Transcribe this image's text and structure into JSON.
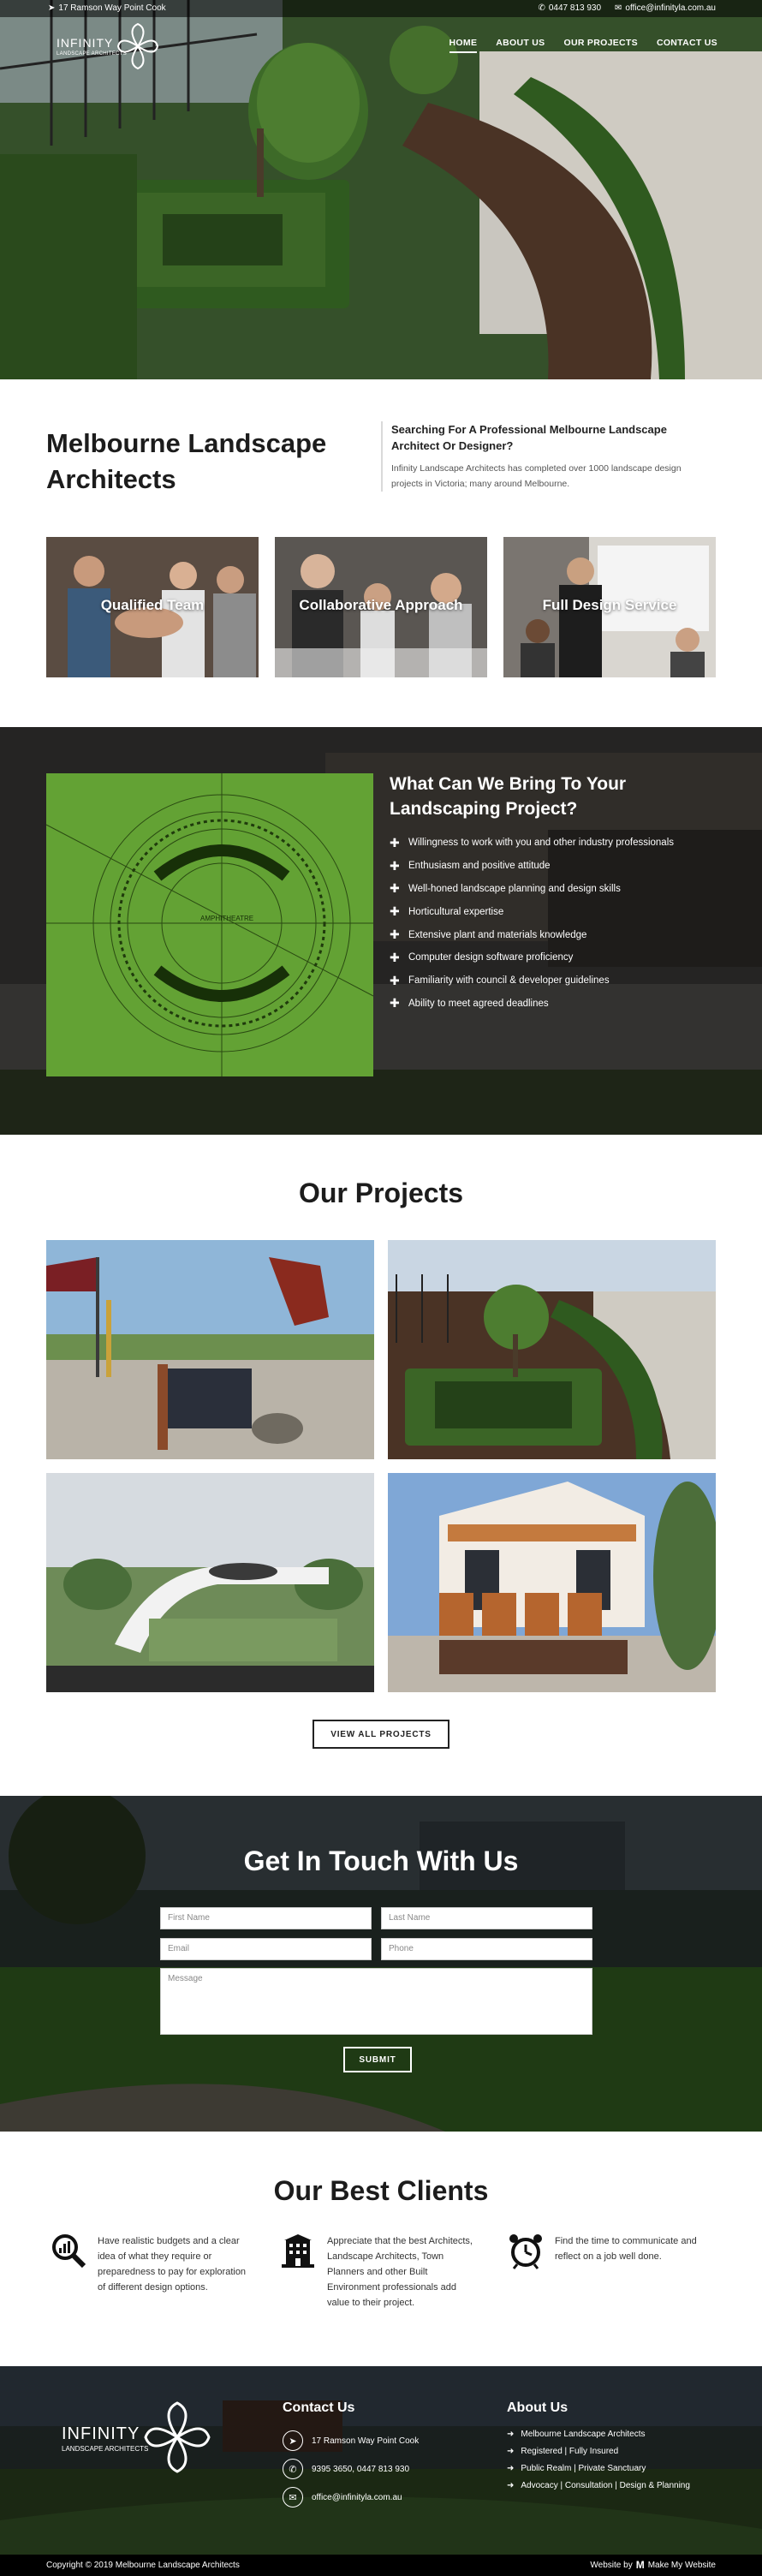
{
  "topbar": {
    "address": "17 Ramson Way Point Cook",
    "phone": "0447 813 930",
    "email": "office@infinityla.com.au"
  },
  "logo": {
    "name": "INFINITY",
    "tagline": "LANDSCAPE ARCHITECTS"
  },
  "nav": [
    {
      "label": "HOME",
      "active": true
    },
    {
      "label": "ABOUT US",
      "active": false
    },
    {
      "label": "OUR PROJECTS",
      "active": false
    },
    {
      "label": "CONTACT US",
      "active": false
    }
  ],
  "intro": {
    "title": "Melbourne Landscape Architects",
    "subtitle": "Searching For A Professional Melbourne Landscape Architect Or Designer?",
    "body": "Infinity Landscape Architects has completed over 1000 landscape design projects in Victoria; many around Melbourne."
  },
  "cards": [
    {
      "label": "Qualified Team"
    },
    {
      "label": "Collaborative Approach"
    },
    {
      "label": "Full Design Service"
    }
  ],
  "bring": {
    "title": "What Can We Bring To Your Landscaping Project?",
    "plan_label": "AMPHITHEATRE",
    "items": [
      "Willingness to work with you and other industry professionals",
      "Enthusiasm and positive attitude",
      "Well-honed landscape planning and design skills",
      "Horticultural expertise",
      "Extensive plant and materials knowledge",
      "Computer design software proficiency",
      "Familiarity with council & developer guidelines",
      "Ability to meet agreed deadlines"
    ]
  },
  "projects": {
    "title": "Our Projects",
    "button": "VIEW ALL PROJECTS"
  },
  "contact": {
    "title": "Get In Touch With Us",
    "first_name": "First Name",
    "last_name": "Last Name",
    "email": "Email",
    "phone": "Phone",
    "message": "Message",
    "submit": "SUBMIT"
  },
  "clients": {
    "title": "Our Best Clients",
    "items": [
      {
        "icon": "magnifier-chart-icon",
        "text": "Have realistic budgets and a clear idea of what they require or preparedness to pay for exploration of different design options."
      },
      {
        "icon": "building-icon",
        "text": "Appreciate that the best Architects, Landscape Architects, Town Planners and other Built Environment professionals add value to their project."
      },
      {
        "icon": "alarm-clock-icon",
        "text": "Find the time to communicate and reflect on a job well done."
      }
    ]
  },
  "footer": {
    "contact_title": "Contact Us",
    "address": "17 Ramson Way Point Cook",
    "phones": "9395 3650, 0447 813 930",
    "email": "office@infinityla.com.au",
    "about_title": "About Us",
    "about_items": [
      "Melbourne Landscape Architects",
      "Registered | Fully Insured",
      "Public Realm | Private Sanctuary",
      "Advocacy | Consultation | Design & Planning"
    ],
    "copyright": "Copyright © 2019 Melbourne Landscape Architects",
    "credit_prefix": "Website by",
    "credit_name": "Make My Website"
  }
}
